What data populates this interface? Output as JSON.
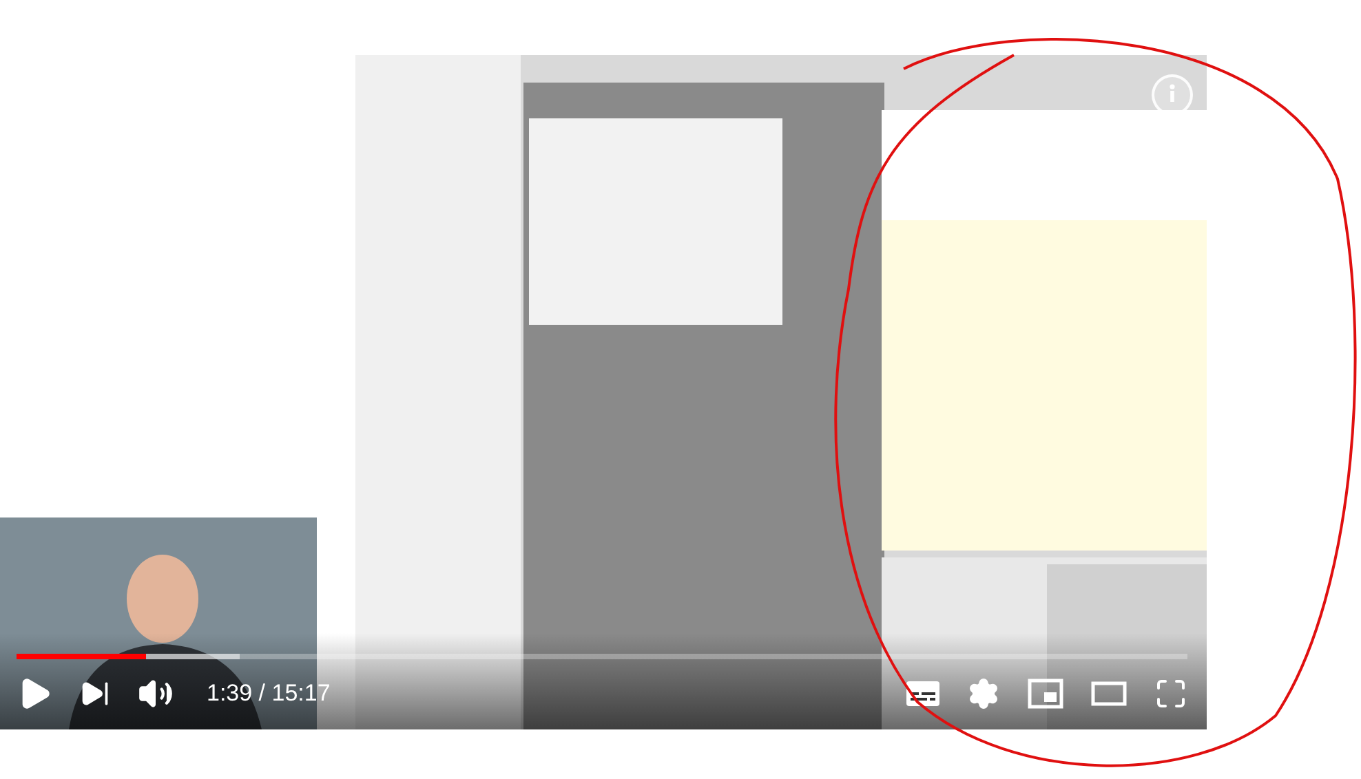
{
  "player": {
    "progress": {
      "level": 0.11
    },
    "buffer": {
      "level": 0.19
    },
    "time": "1:39 / 15:17"
  }
}
